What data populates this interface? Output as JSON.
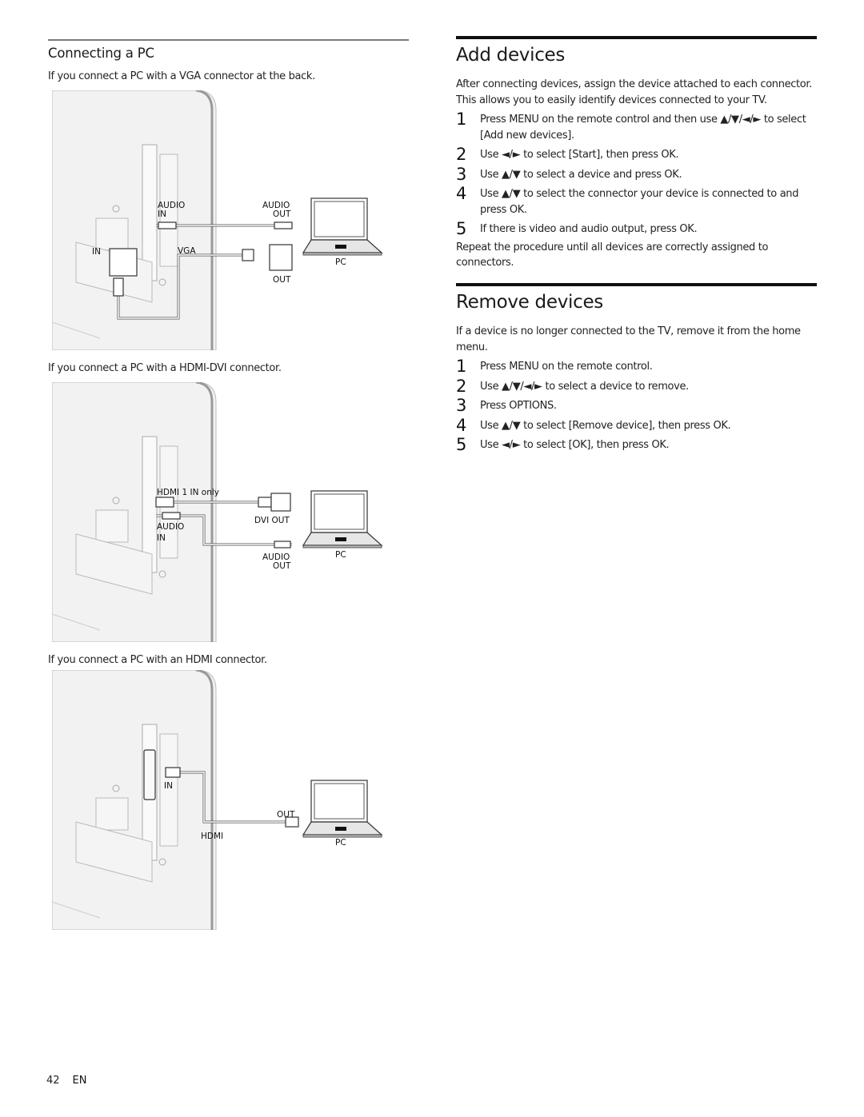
{
  "left": {
    "heading": "Connecting a PC",
    "sections": [
      {
        "caption": "If you connect a PC with a VGA connector at the back.",
        "labels": {
          "audio_in_1": "AUDIO",
          "audio_in_2": "IN",
          "audio_out_1": "AUDIO",
          "audio_out_2": "OUT",
          "in": "IN",
          "vga": "VGA",
          "out": "OUT",
          "pc": "PC"
        }
      },
      {
        "caption": "If you connect a PC with a HDMI-DVI connector.",
        "labels": {
          "hdmi_in": "HDMI 1 IN only",
          "dvi_out": "DVI OUT",
          "audio_in_1": "AUDIO",
          "audio_in_2": "IN",
          "audio_out_1": "AUDIO",
          "audio_out_2": "OUT",
          "pc": "PC"
        }
      },
      {
        "caption": "If you connect a PC with an HDMI connector.",
        "labels": {
          "in": "IN",
          "out": "OUT",
          "hdmi": "HDMI",
          "pc": "PC"
        }
      }
    ]
  },
  "add_devices": {
    "title": "Add devices",
    "intro": "After connecting devices, assign the device attached to each connector. This allows you to easily identify devices connected to your TV.",
    "steps": [
      {
        "num": "1",
        "text": "Press MENU on the remote control and then use ▲/▼/◄/► to select [Add new devices]."
      },
      {
        "num": "2",
        "text": "Use ◄/► to select [Start], then press OK."
      },
      {
        "num": "3",
        "text": "Use ▲/▼ to select a device and press OK."
      },
      {
        "num": "4",
        "text": "Use ▲/▼ to select the connector your device is connected to and press OK."
      },
      {
        "num": "5",
        "text": "If there is video and audio output, press OK."
      }
    ],
    "outro": "Repeat the procedure until all devices are correctly assigned to connectors."
  },
  "remove_devices": {
    "title": "Remove devices",
    "intro": "If a device is no longer connected to the TV, remove it from the home menu.",
    "steps": [
      {
        "num": "1",
        "text": "Press MENU on the remote control."
      },
      {
        "num": "2",
        "text": "Use ▲/▼/◄/► to select a device to remove."
      },
      {
        "num": "3",
        "text": "Press OPTIONS."
      },
      {
        "num": "4",
        "text": "Use ▲/▼ to select [Remove device], then press OK."
      },
      {
        "num": "5",
        "text": "Use ◄/► to select [OK], then press OK."
      }
    ]
  },
  "footer": {
    "page": "42",
    "lang": "EN"
  }
}
